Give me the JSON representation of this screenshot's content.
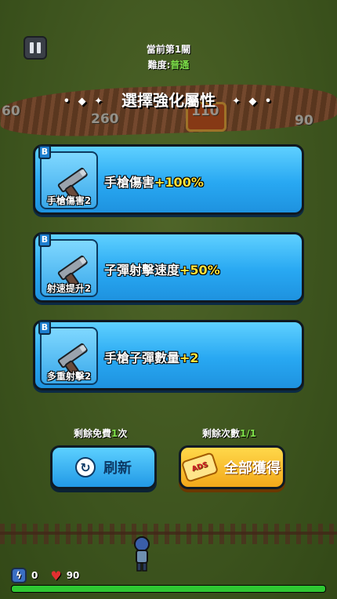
{
  "stage": {
    "text": "當前第1關",
    "difficulty_label": "難度:",
    "difficulty_value": "普通"
  },
  "header": {
    "title": "選擇強化屬性"
  },
  "background_numbers": [
    "60",
    "260",
    "110",
    "90"
  ],
  "cards": [
    {
      "grade": "B",
      "icon": "pistol-icon",
      "subtitle": "手槍傷害2",
      "title": "手槍傷害",
      "bonus": "+100%"
    },
    {
      "grade": "B",
      "icon": "pistol-icon",
      "subtitle": "射速提升2",
      "title": "子彈射擊速度",
      "bonus": "+50%"
    },
    {
      "grade": "B",
      "icon": "pistol-icon",
      "subtitle": "多重射擊2",
      "title": "手槍子彈數量",
      "bonus": "+2"
    }
  ],
  "free_refresh": {
    "prefix": "剩餘免費",
    "count": "1",
    "suffix": "次"
  },
  "remaining": {
    "prefix": "剩餘次數",
    "count": "1/1"
  },
  "buttons": {
    "refresh": "刷新",
    "all": "全部獲得",
    "ads_badge": "ADS"
  },
  "hud": {
    "energy": "0",
    "hp": "90",
    "hp_fill_fraction": 1.0
  },
  "colors": {
    "card_blue": "#28a8f2",
    "bonus_yellow": "#ffe23a",
    "accent_green": "#7fe24a",
    "hp_green": "#2ec832"
  }
}
